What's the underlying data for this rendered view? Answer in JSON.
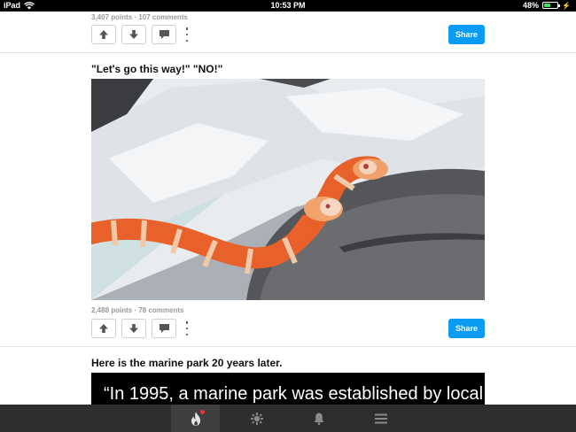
{
  "status_bar": {
    "device": "iPad",
    "time": "10:53 PM",
    "battery_text": "48%",
    "battery_level": 0.48
  },
  "posts": [
    {
      "meta": "3,407 points · 107 comments",
      "share_label": "Share"
    },
    {
      "title": "\"Let's go this way!\" \"NO!\"",
      "meta": "2,488 points · 78 comments",
      "share_label": "Share"
    },
    {
      "title": "Here is the marine park 20 years later.",
      "image_text": "“In 1995, a marine park was established by local"
    }
  ],
  "icons": {
    "upvote": "up-arrow-icon",
    "downvote": "down-arrow-icon",
    "comment": "comment-bubble-icon",
    "more": "more-vertical-icon"
  },
  "tabbar": {
    "tabs": [
      "hot",
      "explore",
      "notifications",
      "menu"
    ],
    "active": "hot",
    "notification_dot_color": "#e53935"
  },
  "colors": {
    "share": "#0a9bf5",
    "tabbar": "#2e2e2e"
  }
}
